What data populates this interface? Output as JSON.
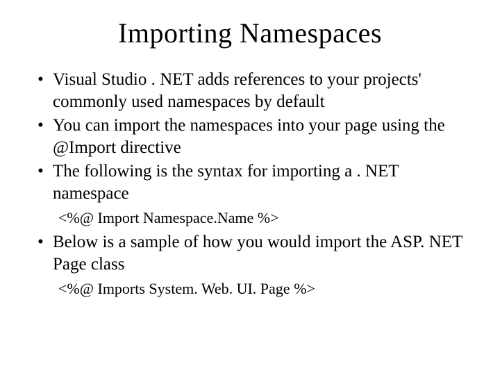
{
  "title": "Importing Namespaces",
  "bullets": {
    "b1": "Visual Studio . NET adds references to your projects' commonly used namespaces by default",
    "b2": "You can import the namespaces into your page using the @Import directive",
    "b3": "The following is the syntax for importing a . NET namespace",
    "b4": "Below is a sample of how you would import the ASP. NET Page class"
  },
  "code": {
    "c1": "<%@ Import Namespace.Name  %>",
    "c2": "<%@ Imports System. Web. UI. Page %>"
  }
}
